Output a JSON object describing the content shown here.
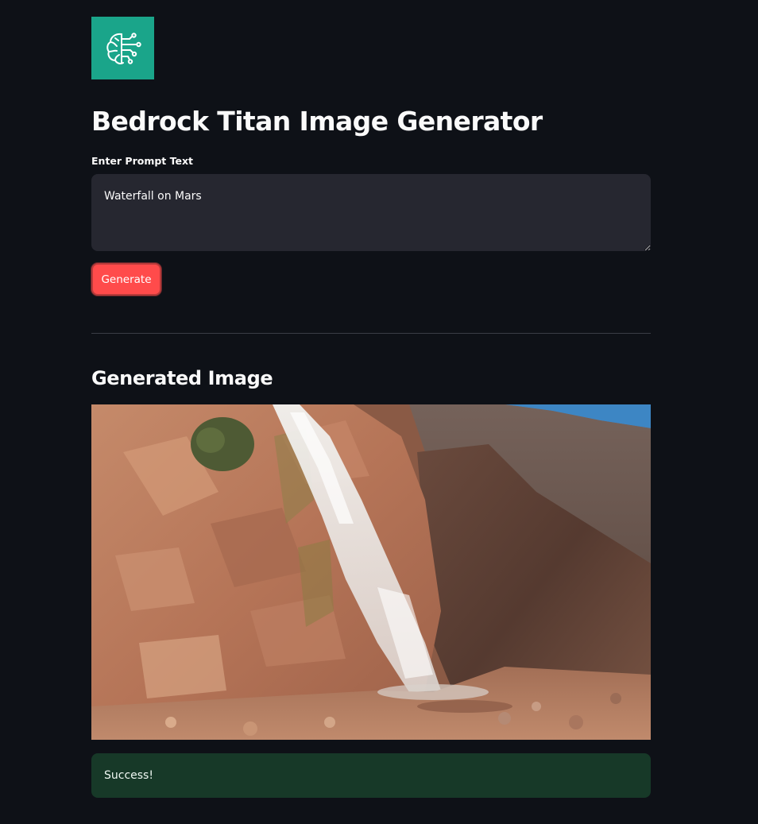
{
  "app": {
    "title": "Bedrock Titan Image Generator",
    "logo_icon": "brain-circuit-icon"
  },
  "prompt": {
    "label": "Enter Prompt Text",
    "value": "Waterfall on Mars"
  },
  "actions": {
    "generate_label": "Generate"
  },
  "result": {
    "heading": "Generated Image",
    "image_subject": "waterfall-over-red-rocks",
    "status_message": "Success!"
  },
  "colors": {
    "background": "#0e1117",
    "logo": "#1aa58a",
    "input": "#262730",
    "primary_button": "#ff4b4b",
    "success_bg": "#173928"
  }
}
